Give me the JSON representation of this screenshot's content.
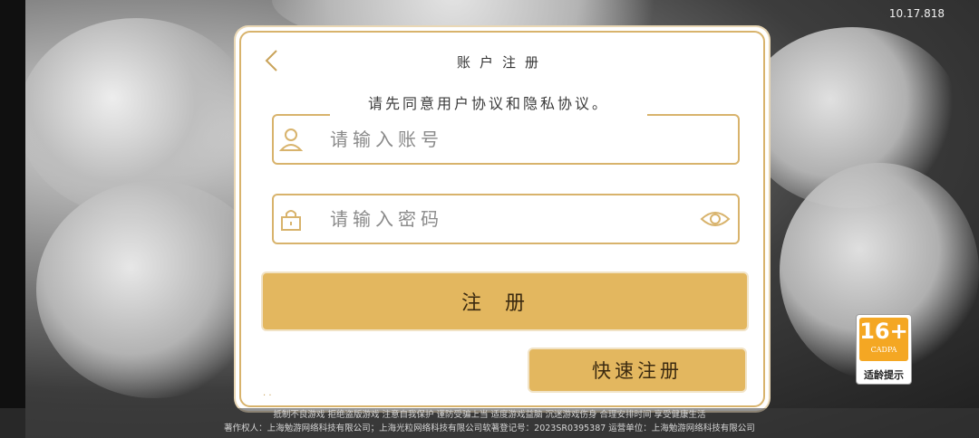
{
  "status": {
    "version": "10.17.818"
  },
  "dialog": {
    "title": "账户注册",
    "toast": "请先同意用户协议和隐私协议。",
    "account_placeholder": "请输入账号",
    "password_placeholder": "请输入密码",
    "register_label": "注册",
    "quick_register_label": "快速注册",
    "agreement_mark": "· ·"
  },
  "age_rating": {
    "rating": "16+",
    "org": "CADPA",
    "label": "适龄提示"
  },
  "footer": {
    "line1": "抵制不良游戏 拒绝盗版游戏 注意自我保护 谨防受骗上当 适度游戏益脑 沉迷游戏伤身 合理安排时间 享受健康生活",
    "line2": "著作权人：上海勉游网络科技有限公司；上海光粒网络科技有限公司软著登记号：2023SR0395387 运营单位：上海勉游网络科技有限公司"
  },
  "colors": {
    "accent": "#e3b75f",
    "border": "#d8b36c",
    "badge": "#f4a723"
  },
  "icons": [
    "back-arrow-icon",
    "user-icon",
    "lock-icon",
    "eye-icon"
  ]
}
